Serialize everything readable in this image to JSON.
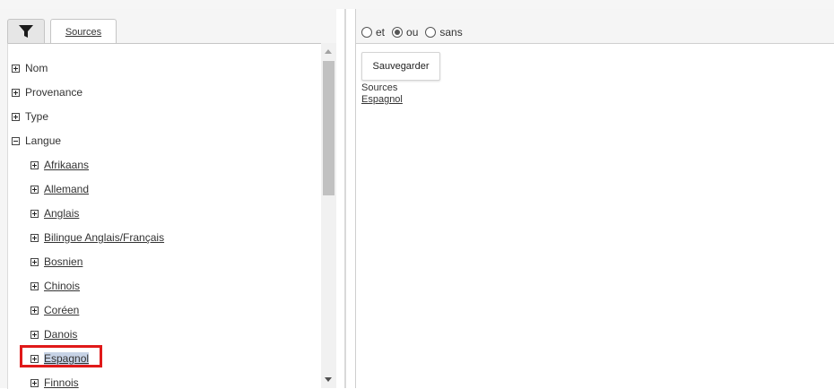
{
  "left_panel": {
    "tabs": [
      {
        "icon": "filter-icon",
        "label": ""
      },
      {
        "label": "Sources"
      }
    ],
    "tree": [
      {
        "label": "Nom",
        "expanded": false
      },
      {
        "label": "Provenance",
        "expanded": false
      },
      {
        "label": "Type",
        "expanded": false
      },
      {
        "label": "Langue",
        "expanded": true,
        "children": [
          {
            "label": "Afrikaans"
          },
          {
            "label": "Allemand"
          },
          {
            "label": "Anglais"
          },
          {
            "label": "Bilingue Anglais/Français"
          },
          {
            "label": "Bosnien"
          },
          {
            "label": "Chinois"
          },
          {
            "label": "Coréen"
          },
          {
            "label": "Danois"
          },
          {
            "label": "Espagnol",
            "selected": true
          },
          {
            "label": "Finnois"
          }
        ]
      }
    ]
  },
  "right_panel": {
    "operators": [
      {
        "label": "et",
        "checked": false
      },
      {
        "label": "ou",
        "checked": true
      },
      {
        "label": "sans",
        "checked": false
      }
    ],
    "save_label": "Sauvegarder",
    "criteria_title": "Sources",
    "criteria_value": "Espagnol"
  },
  "colors": {
    "highlight_border": "#e01919",
    "selected_bg": "#c7d3e6"
  }
}
